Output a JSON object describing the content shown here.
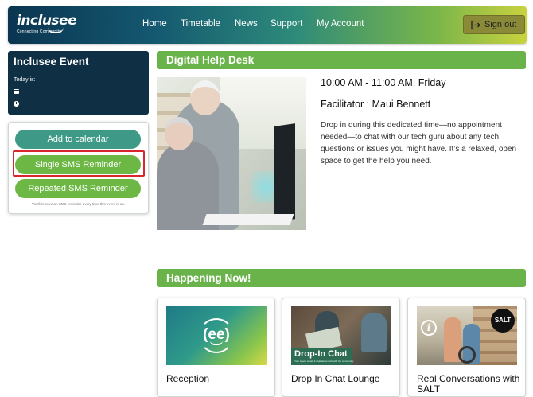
{
  "header": {
    "logo": {
      "word": "inclusee",
      "tagline": "Connecting Community"
    },
    "nav": [
      {
        "label": "Home"
      },
      {
        "label": "Timetable"
      },
      {
        "label": "News"
      },
      {
        "label": "Support"
      },
      {
        "label": "My Account"
      }
    ],
    "sign_out": {
      "label": "Sign out",
      "icon": "sign-out-icon"
    },
    "gradient_colors": [
      "#0b3550",
      "#2d8a7a",
      "#c9d23e"
    ]
  },
  "sidebar": {
    "event_title": "Inclusee Event",
    "today_label": "Today is:",
    "icons": [
      "calendar-icon",
      "clock-icon"
    ],
    "buttons": {
      "add_to_calendar": "Add to calendar",
      "single_sms": "Single SMS Reminder",
      "repeated_sms": "Repeated SMS Reminder"
    },
    "sms_note": "You'll receive an SMS reminder every time this event is on.",
    "highlighted_button": "single_sms"
  },
  "help_desk": {
    "heading": "Digital Help Desk",
    "time": "10:00 AM - 11:00 AM, Friday",
    "facilitator": "Facilitator : Maui Bennett",
    "description": "Drop in during this dedicated time—no appointment needed—to chat with our tech guru about any tech questions or issues you might have. It’s a relaxed, open space to get the help you need."
  },
  "happening_now": {
    "heading": "Happening Now!",
    "cards": [
      {
        "title": "Reception",
        "image_text": "(ee)"
      },
      {
        "title": "Drop In Chat Lounge",
        "image_text": "Drop-In Chat",
        "image_subtext": "Your space to ask & chat about tech with the community"
      },
      {
        "title": "Real Conversations with SALT",
        "image_text": "SALT",
        "image_icon": "i"
      }
    ]
  },
  "colors": {
    "accent_green": "#6ab34a",
    "teal_button": "#3e9a87",
    "navy": "#0f2f45",
    "highlight_red": "#d9262c"
  }
}
